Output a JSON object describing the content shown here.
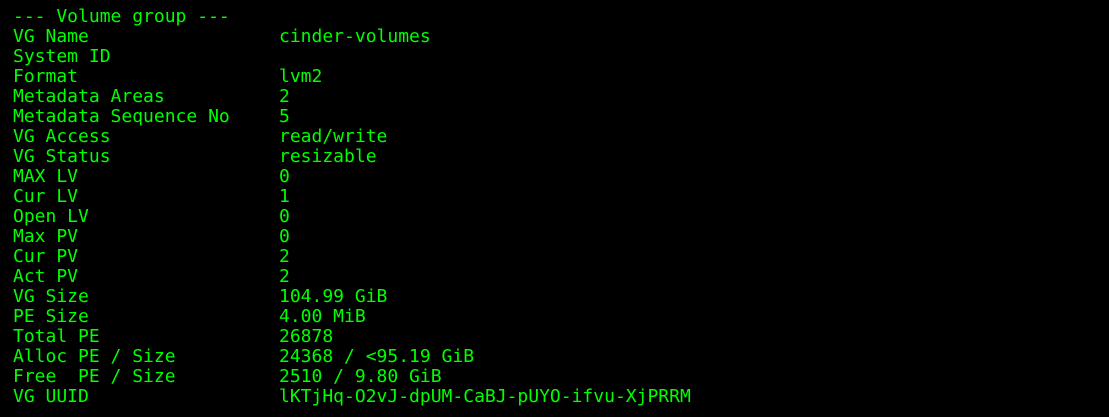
{
  "terminal": {
    "header": "--- Volume group ---",
    "text_color": "#00ff00",
    "background": "#000000",
    "rows": [
      {
        "key": "VG Name",
        "value": "cinder-volumes"
      },
      {
        "key": "System ID",
        "value": ""
      },
      {
        "key": "Format",
        "value": "lvm2"
      },
      {
        "key": "Metadata Areas",
        "value": "2"
      },
      {
        "key": "Metadata Sequence No",
        "value": "5"
      },
      {
        "key": "VG Access",
        "value": "read/write"
      },
      {
        "key": "VG Status",
        "value": "resizable"
      },
      {
        "key": "MAX LV",
        "value": "0"
      },
      {
        "key": "Cur LV",
        "value": "1"
      },
      {
        "key": "Open LV",
        "value": "0"
      },
      {
        "key": "Max PV",
        "value": "0"
      },
      {
        "key": "Cur PV",
        "value": "2"
      },
      {
        "key": "Act PV",
        "value": "2"
      },
      {
        "key": "VG Size",
        "value": "104.99 GiB"
      },
      {
        "key": "PE Size",
        "value": "4.00 MiB"
      },
      {
        "key": "Total PE",
        "value": "26878"
      },
      {
        "key": "Alloc PE / Size",
        "value": "24368 / <95.19 GiB"
      },
      {
        "key": "Free  PE / Size",
        "value": "2510 / 9.80 GiB"
      },
      {
        "key": "VG UUID",
        "value": "lKTjHq-O2vJ-dpUM-CaBJ-pUYO-ifvu-XjPRRM"
      }
    ]
  }
}
